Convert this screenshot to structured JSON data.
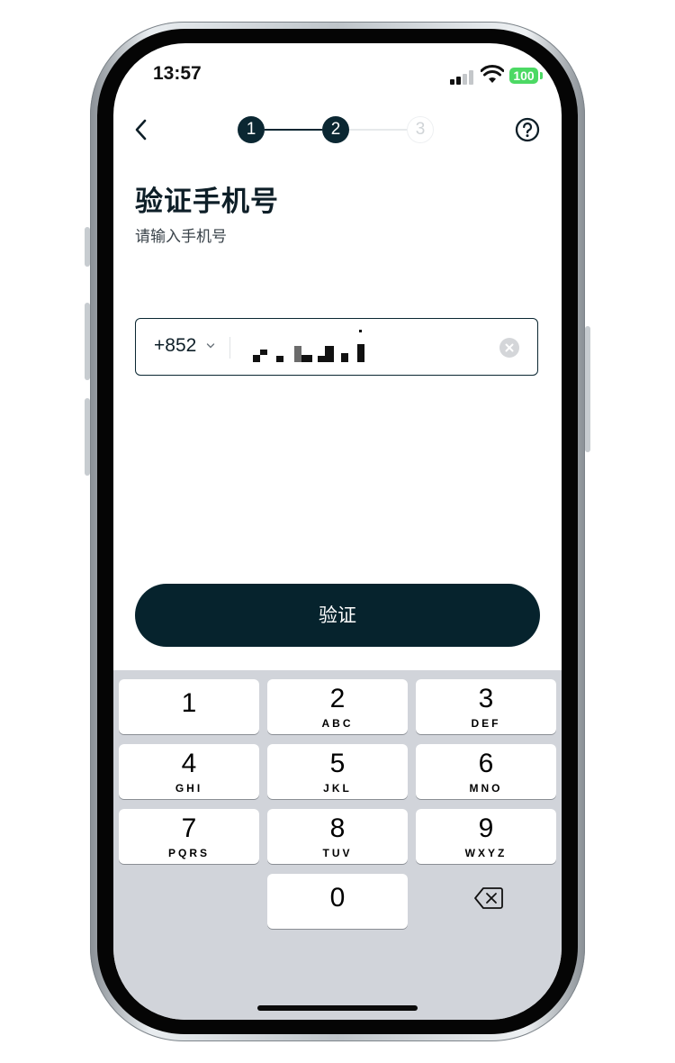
{
  "status_bar": {
    "time": "13:57",
    "battery": "100"
  },
  "nav": {
    "steps": [
      {
        "label": "1",
        "state": "done"
      },
      {
        "label": "2",
        "state": "current"
      },
      {
        "label": "3",
        "state": "todo"
      }
    ]
  },
  "page": {
    "title": "验证手机号",
    "subtitle": "请输入手机号"
  },
  "phone": {
    "country_code": "+852"
  },
  "verify_button": {
    "label": "验证"
  },
  "keypad": {
    "keys": [
      {
        "num": "1",
        "letters": ""
      },
      {
        "num": "2",
        "letters": "ABC"
      },
      {
        "num": "3",
        "letters": "DEF"
      },
      {
        "num": "4",
        "letters": "GHI"
      },
      {
        "num": "5",
        "letters": "JKL"
      },
      {
        "num": "6",
        "letters": "MNO"
      },
      {
        "num": "7",
        "letters": "PQRS"
      },
      {
        "num": "8",
        "letters": "TUV"
      },
      {
        "num": "9",
        "letters": "WXYZ"
      },
      {
        "num": "0",
        "letters": ""
      }
    ]
  },
  "colors": {
    "primary": "#06232d",
    "step_done": "#0b2732",
    "battery": "#4cd964",
    "keyboard_bg": "#d1d4da"
  },
  "icons": {
    "back": "chevron-left-icon",
    "help": "question-circle-icon",
    "clear": "clear-circle-icon",
    "backspace": "backspace-icon",
    "wifi": "wifi-icon",
    "signal": "cellular-signal-icon"
  }
}
